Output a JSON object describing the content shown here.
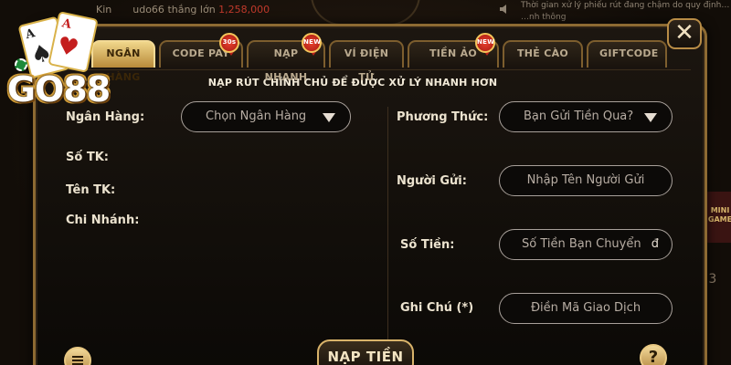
{
  "background": {
    "ticker_prefix": "Kin",
    "ticker_user": "udo66",
    "ticker_action": "thắng lớn",
    "ticker_amount": "1,258,000",
    "notice_text": "Thời gian xử lý phiếu rút đang chậm do quy định… …nh thông",
    "mini_game": "MINI GAME",
    "side_number": "2,3"
  },
  "logo": {
    "text": "GO88",
    "card_rank_1": "A",
    "card_suit_1": "♠",
    "card_rank_2": "A",
    "card_suit_2": "♥"
  },
  "tabs": [
    {
      "label": "NGÂN HÀNG",
      "active": true,
      "badge": ""
    },
    {
      "label": "CODE PAY",
      "active": false,
      "badge": "30s"
    },
    {
      "label": "NẠP NHANH",
      "active": false,
      "badge": "NEW"
    },
    {
      "label": "VÍ ĐIỆN TỬ",
      "active": false,
      "badge": ""
    },
    {
      "label": "TIỀN ẢO",
      "active": false,
      "badge": "NEW"
    },
    {
      "label": "THẺ CÀO",
      "active": false,
      "badge": ""
    },
    {
      "label": "GIFTCODE",
      "active": false,
      "badge": ""
    }
  ],
  "panel": {
    "heading": "NẠP RÚT CHÍNH CHỦ ĐỂ ĐƯỢC XỬ LÝ NHANH HƠN",
    "left": {
      "bank_label": "Ngân Hàng:",
      "bank_placeholder": "Chọn Ngân Hàng",
      "account_no_label": "Số TK:",
      "account_name_label": "Tên TK:",
      "branch_label": "Chi Nhánh:"
    },
    "right": {
      "method_label": "Phương Thức:",
      "method_placeholder": "Bạn Gửi Tiền Qua?",
      "sender_label": "Người Gửi:",
      "sender_placeholder": "Nhập Tên Người Gửi",
      "amount_label": "Số Tiền:",
      "amount_placeholder": "Số Tiền Bạn Chuyển",
      "amount_suffix": "đ",
      "note_label": "Ghi Chú (*)",
      "note_placeholder": "Điền Mã Giao Dịch"
    }
  },
  "buttons": {
    "submit": "NẠP TIỀN",
    "close": "✕",
    "help": "?"
  }
}
